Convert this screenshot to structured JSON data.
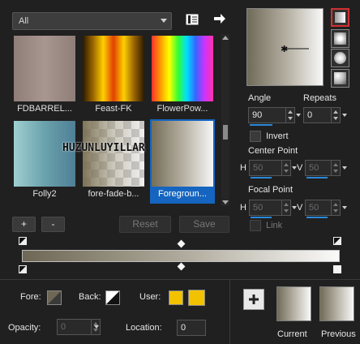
{
  "category_dropdown": {
    "value": "All"
  },
  "gallery": {
    "items": [
      {
        "label": "FDBARREL...",
        "gradient": "linear-gradient(90deg,#8f7d78,#a89690,#8f7d78)"
      },
      {
        "label": "Feast-FK",
        "gradient": "linear-gradient(90deg,#2a1a00,#9a6400,#ffd000,#e04000,#ffd000,#9a6400,#2a1a00)"
      },
      {
        "label": "FlowerPow...",
        "gradient": "linear-gradient(90deg,#ff3030,#ff9900,#ffff00,#33ff33,#00ddff,#3366ff,#cc33ff,#ff33aa)"
      },
      {
        "label": "Folly2",
        "gradient": "linear-gradient(90deg,#a0cfd0,#6aa2ad,#4f7f95)"
      },
      {
        "label": "fore-fade-b...",
        "gradient": ""
      },
      {
        "label": "Foregroun...",
        "gradient": "linear-gradient(90deg,#746d58,#b4aea0,#f6f6f6)"
      }
    ],
    "selected_index": 5,
    "watermark": "HUZUNLUYILLAR"
  },
  "buttons": {
    "add": "+",
    "remove": "-",
    "reset": "Reset",
    "save": "Save"
  },
  "angle": {
    "label": "Angle",
    "value": "90"
  },
  "repeats": {
    "label": "Repeats",
    "value": "0"
  },
  "invert": {
    "label": "Invert",
    "checked": false
  },
  "center_point": {
    "label": "Center Point",
    "h_label": "H",
    "h_value": "50",
    "v_label": "V",
    "v_value": "50"
  },
  "focal_point": {
    "label": "Focal Point",
    "h_label": "H",
    "h_value": "50",
    "v_label": "V",
    "v_value": "50"
  },
  "link": {
    "label": "Link",
    "checked": false
  },
  "fore": {
    "label": "Fore:"
  },
  "back": {
    "label": "Back:"
  },
  "user": {
    "label": "User:",
    "color": "#f2c200"
  },
  "opacity": {
    "label": "Opacity:",
    "value": "0"
  },
  "location": {
    "label": "Location:",
    "value": "0"
  },
  "current": {
    "label": "Current"
  },
  "previous": {
    "label": "Previous"
  },
  "icons": {
    "library": "book-icon",
    "export": "arrow-right-icon",
    "add": "plus-icon"
  }
}
